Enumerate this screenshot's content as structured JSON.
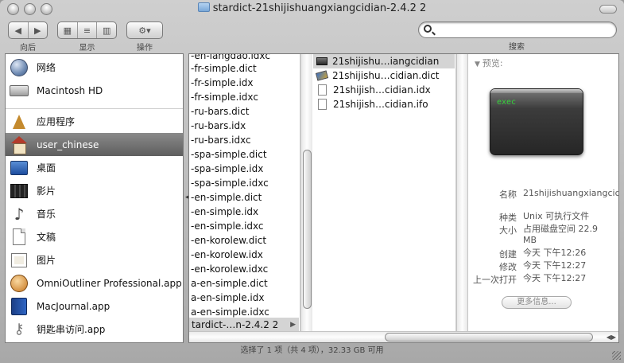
{
  "window": {
    "title": "stardict-21shijishuangxiangcidian-2.4.2 2"
  },
  "toolbar": {
    "back_label": "向后",
    "view_label": "显示",
    "action_label": "操作",
    "search_label": "搜索",
    "search_placeholder": ""
  },
  "sidebar": {
    "items": [
      {
        "label": "网络",
        "icon": "network-icon"
      },
      {
        "label": "Macintosh HD",
        "icon": "hard-disk-icon"
      },
      {
        "label": "应用程序",
        "icon": "applications-icon"
      },
      {
        "label": "user_chinese",
        "icon": "home-icon",
        "selected": true
      },
      {
        "label": "桌面",
        "icon": "desktop-icon"
      },
      {
        "label": "影片",
        "icon": "movies-icon"
      },
      {
        "label": "音乐",
        "icon": "music-icon"
      },
      {
        "label": "文稿",
        "icon": "documents-icon"
      },
      {
        "label": "图片",
        "icon": "pictures-icon"
      },
      {
        "label": "OmniOutliner Professional.app",
        "icon": "omnioutliner-icon"
      },
      {
        "label": "MacJournal.app",
        "icon": "macjournal-icon"
      },
      {
        "label": "钥匙串访问.app",
        "icon": "keychain-icon"
      }
    ]
  },
  "column1": {
    "items": [
      "-en-langdao.idxc",
      "-fr-simple.dict",
      "-fr-simple.idx",
      "-fr-simple.idxc",
      "-ru-bars.dict",
      "-ru-bars.idx",
      "-ru-bars.idxc",
      "-spa-simple.dict",
      "-spa-simple.idx",
      "-spa-simple.idxc",
      "-en-simple.dict",
      "-en-simple.idx",
      "-en-simple.idxc",
      "-en-korolew.dict",
      "-en-korolew.idx",
      "-en-korolew.idxc",
      "a-en-simple.dict",
      "a-en-simple.idx",
      "a-en-simple.idxc"
    ],
    "selected": "tardict-…n-2.4.2 2"
  },
  "column2": {
    "items": [
      {
        "label": "21shijishu…iangcidian",
        "kind": "exec",
        "selected": true
      },
      {
        "label": "21shijishu…cidian.dict",
        "kind": "dict"
      },
      {
        "label": "21shijish…cidian.idx",
        "kind": "doc"
      },
      {
        "label": "21shijish…cidian.ifo",
        "kind": "doc"
      }
    ]
  },
  "preview": {
    "heading": "预览:",
    "terminal_text": "exec",
    "info": [
      {
        "key": "名称",
        "value": "21shijishuangxiangcidian"
      },
      {
        "key": "种类",
        "value": "Unix 可执行文件"
      },
      {
        "key": "大小",
        "value": "占用磁盘空间 22.9 MB"
      },
      {
        "key": "创建",
        "value": "今天 下午12:26"
      },
      {
        "key": "修改",
        "value": "今天 下午12:27"
      },
      {
        "key": "上一次打开",
        "value": "今天 下午12:27"
      }
    ],
    "more_button": "更多信息..."
  },
  "status": {
    "text": "选择了 1 项（共 4 项），32.33 GB 可用"
  }
}
